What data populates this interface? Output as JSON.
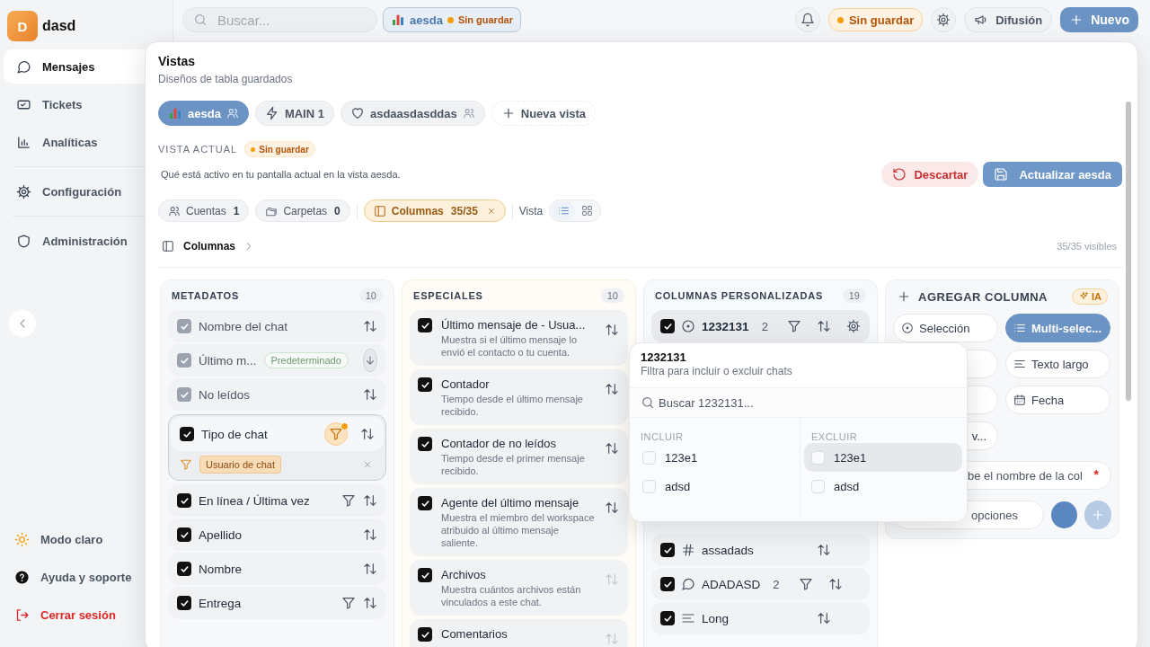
{
  "sidebar": {
    "brand": {
      "initial": "D",
      "name": "dasd"
    },
    "sections": [
      {
        "items": [
          {
            "label": "Mensajes",
            "selected": true
          },
          {
            "label": "Tickets",
            "selected": false
          },
          {
            "label": "Analíticas",
            "selected": false
          }
        ]
      },
      {
        "items": [
          {
            "label": "Configuración",
            "selected": false
          }
        ]
      },
      {
        "items": [
          {
            "label": "Administración",
            "selected": false
          }
        ]
      }
    ],
    "footer": [
      {
        "label": "Modo claro",
        "kind": "theme"
      },
      {
        "label": "Ayuda y soporte",
        "kind": "help"
      },
      {
        "label": "Cerrar sesión",
        "kind": "logout"
      }
    ]
  },
  "topbar": {
    "search": {
      "placeholder": "Buscar..."
    },
    "view_chip": {
      "name": "aesda",
      "status": "Sin guardar"
    },
    "status_badge": "Sin guardar",
    "broadcast_button": "Difusión",
    "new_button": "Nuevo"
  },
  "views_panel": {
    "title": "Vistas",
    "subtitle": "Diseños de tabla guardados",
    "views": [
      {
        "label": "aesda",
        "selected": true,
        "shared": true
      },
      {
        "label": "MAIN 1",
        "selected": false,
        "shared": false
      },
      {
        "label": "asdaasdasddas",
        "selected": false,
        "shared": true
      }
    ],
    "new_view": "Nueva vista",
    "current": {
      "label": "VISTA ACTUAL",
      "status": "Sin guardar",
      "description": "Qué está activo en tu pantalla actual en la vista aesda.",
      "discard": "Descartar",
      "update": "Actualizar aesda"
    },
    "filters": [
      {
        "label": "Cuentas",
        "count": "1",
        "active": false
      },
      {
        "label": "Carpetas",
        "count": "0",
        "active": false
      },
      {
        "label": "Columnas",
        "count": "35/35",
        "active": true
      }
    ],
    "view_toggle": {
      "label": "Vista",
      "modes": [
        {
          "selected": true
        },
        {
          "selected": false
        }
      ]
    },
    "breadcrumb": "Columnas",
    "visible_count": "35/35 visibles",
    "groups": [
      {
        "kind": "fields",
        "title": "METADATOS",
        "count": "10",
        "items": [
          {
            "label": "Nombre del chat",
            "checked": true,
            "locked": true,
            "filterable": false,
            "filter_applied": false,
            "default_sort": false,
            "expanded": false
          },
          {
            "label": "Último m...",
            "checked": true,
            "locked": true,
            "badge": "Predeterminado",
            "filterable": false,
            "filter_applied": false,
            "default_sort": true,
            "expanded": false
          },
          {
            "label": "No leídos",
            "checked": true,
            "locked": true,
            "filterable": false,
            "filter_applied": false,
            "default_sort": false,
            "expanded": false
          },
          {
            "label": "Tipo de chat",
            "checked": true,
            "locked": false,
            "filterable": true,
            "filter_applied": true,
            "default_sort": false,
            "expanded": true,
            "filter_values": [
              "Usuario de chat"
            ]
          },
          {
            "label": "En línea / Última vez",
            "checked": true,
            "locked": false,
            "filterable": true,
            "filter_applied": false,
            "default_sort": false,
            "expanded": false
          },
          {
            "label": "Apellido",
            "checked": true,
            "locked": false,
            "filterable": false,
            "filter_applied": false,
            "default_sort": false,
            "expanded": false
          },
          {
            "label": "Nombre",
            "checked": true,
            "locked": false,
            "filterable": false,
            "filter_applied": false,
            "default_sort": false,
            "expanded": false
          },
          {
            "label": "Entrega",
            "checked": true,
            "locked": false,
            "filterable": true,
            "filter_applied": false,
            "default_sort": false,
            "expanded": false
          }
        ]
      },
      {
        "kind": "special",
        "title": "ESPECIALES",
        "count": "10",
        "items": [
          {
            "label": "Último mensaje de - Usua...",
            "description": "Muestra si el último mensaje lo envió el contacto o tu cuenta.",
            "checked": true,
            "sortable": true
          },
          {
            "label": "Contador",
            "description": "Tiempo desde el último mensaje recibido.",
            "checked": true,
            "sortable": true
          },
          {
            "label": "Contador de no leídos",
            "description": "Tiempo desde el primer mensaje recibido.",
            "checked": true,
            "sortable": true
          },
          {
            "label": "Agente del último mensaje",
            "description": "Muestra el miembro del workspace atribuido al último mensaje saliente.",
            "checked": true,
            "sortable": true
          },
          {
            "label": "Archivos",
            "description": "Muestra cuántos archivos están vinculados a este chat.",
            "checked": true,
            "sortable": false
          },
          {
            "label": "Comentarios",
            "checked": true,
            "sortable": false
          }
        ]
      },
      {
        "kind": "custom",
        "title": "COLUMNAS PERSONALIZADAS",
        "count": "19",
        "items": [
          {
            "label": "1232131",
            "kind": "select",
            "checked": true,
            "count": "2",
            "filterable": true,
            "settings": true,
            "highlighted": true
          },
          {
            "label": "assadads",
            "kind": "number",
            "checked": true,
            "filterable": false,
            "settings": false,
            "highlighted": false
          },
          {
            "label": "ADADASD",
            "kind": "comment",
            "checked": true,
            "count": "2",
            "filterable": true,
            "settings": false,
            "highlighted": false
          },
          {
            "label": "Long",
            "kind": "long_text",
            "checked": true,
            "filterable": false,
            "settings": false,
            "highlighted": false
          }
        ]
      }
    ],
    "add_column": {
      "title": "AGREGAR COLUMNA",
      "ai_badge": "IA",
      "types": [
        {
          "label": "Selección",
          "selected": false
        },
        {
          "label": "Multi-selec...",
          "selected": true
        },
        {
          "label": "Texto largo",
          "selected": false
        },
        {
          "label": "Fecha",
          "selected": false
        },
        {
          "label": "v...",
          "selected": false
        }
      ],
      "name_placeholder": "be el nombre de la col",
      "required_mark": "*",
      "options_placeholder": "opciones"
    },
    "filter_popover": {
      "title": "1232131",
      "subtitle": "Filtra para incluir o excluir chats",
      "search_placeholder": "Buscar 1232131...",
      "lists": [
        {
          "label": "INCLUIR",
          "options": [
            {
              "label": "123e1",
              "checked": false,
              "highlighted": false
            },
            {
              "label": "adsd",
              "checked": false,
              "highlighted": false
            }
          ]
        },
        {
          "label": "EXCLUIR",
          "options": [
            {
              "label": "123e1",
              "checked": false,
              "highlighted": true
            },
            {
              "label": "adsd",
              "checked": false,
              "highlighted": false
            }
          ]
        }
      ]
    }
  }
}
